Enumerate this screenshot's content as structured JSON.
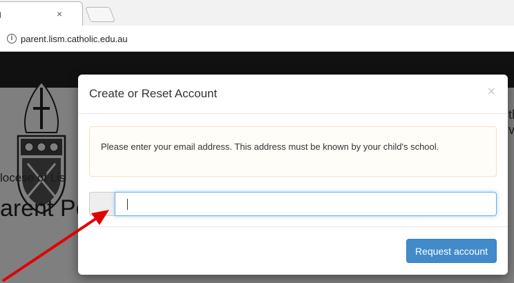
{
  "browser": {
    "tab_title": "rtal",
    "tab_close": "×",
    "url": "parent.lism.catholic.edu.au",
    "info_icon": "ⓘ"
  },
  "page": {
    "diocese_text": "locese of Lis",
    "portal_text": "arent Pc",
    "side_text_1": "th",
    "side_text_2": "vi"
  },
  "modal": {
    "title": "Create or Reset Account",
    "close_label": "×",
    "alert_text": "Please enter your email address. This address must be known by your child's school.",
    "email_value": "",
    "email_placeholder": "",
    "submit_label": "Request account"
  },
  "colors": {
    "primary": "#428bca",
    "overlay": "rgba(0,0,0,0.5)",
    "annotation_arrow": "#e00000"
  }
}
